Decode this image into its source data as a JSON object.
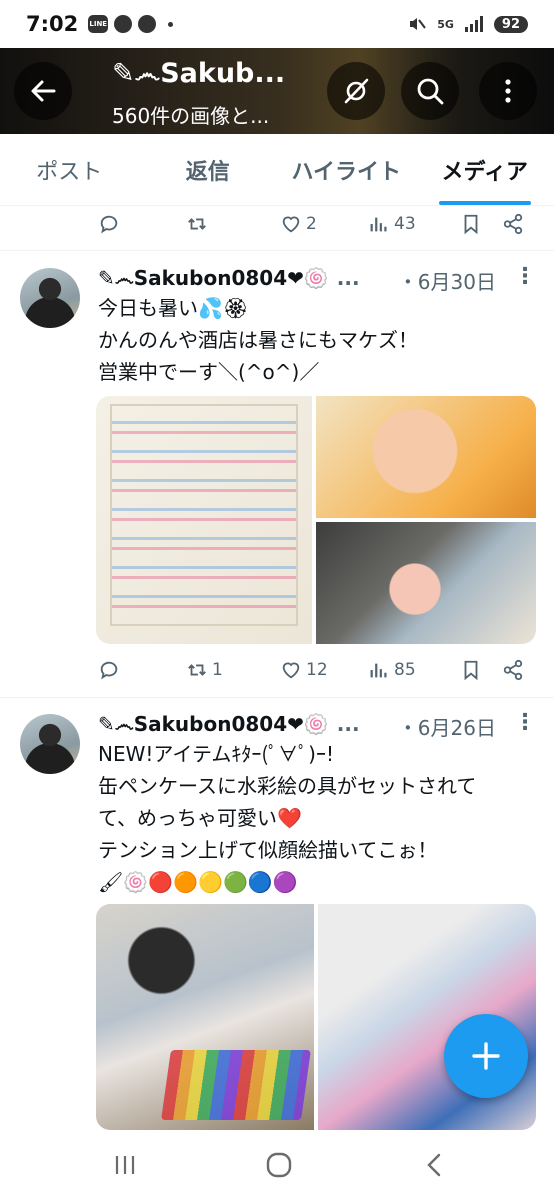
{
  "status_bar": {
    "time": "7:02",
    "battery": "92",
    "network": "5G",
    "line_label": "LINE"
  },
  "header": {
    "title": "✎෴Sakub...",
    "subtitle": "560件の画像と..."
  },
  "tabs": [
    {
      "label": "ポスト",
      "active": false
    },
    {
      "label": "返信",
      "active": false
    },
    {
      "label": "ハイライト",
      "active": false
    },
    {
      "label": "メディア",
      "active": true
    }
  ],
  "top_actions": {
    "replies": "",
    "reposts": "",
    "likes": "2",
    "views": "43"
  },
  "tweets": [
    {
      "name": "✎෴Sakubon0804❤🍥",
      "ellipsis": "...",
      "date": "・6月30日",
      "text": "今日も暑い💦🏵\nかんのんや酒店は暑さにもマケズ！\n営業中でーす＼(^o^)／",
      "actions": {
        "replies": "",
        "reposts": "1",
        "likes": "12",
        "views": "85"
      }
    },
    {
      "name": "✎෴Sakubon0804❤🍥",
      "ellipsis": "...",
      "date": "・6月26日",
      "text": "NEW!アイテムｷﾀｰ(ﾟ∀ﾟ)ｰ!\n缶ペンケースに水彩絵の具がセットされて\nて、めっちゃ可愛い❤️\nテンション上げて似顔絵描いてこぉ！\n🖌🍥🔴🟠🟡🟢🔵🟣"
    }
  ],
  "colors": {
    "accent": "#1d9bf0",
    "text": "#0f1419",
    "muted": "#536471"
  }
}
